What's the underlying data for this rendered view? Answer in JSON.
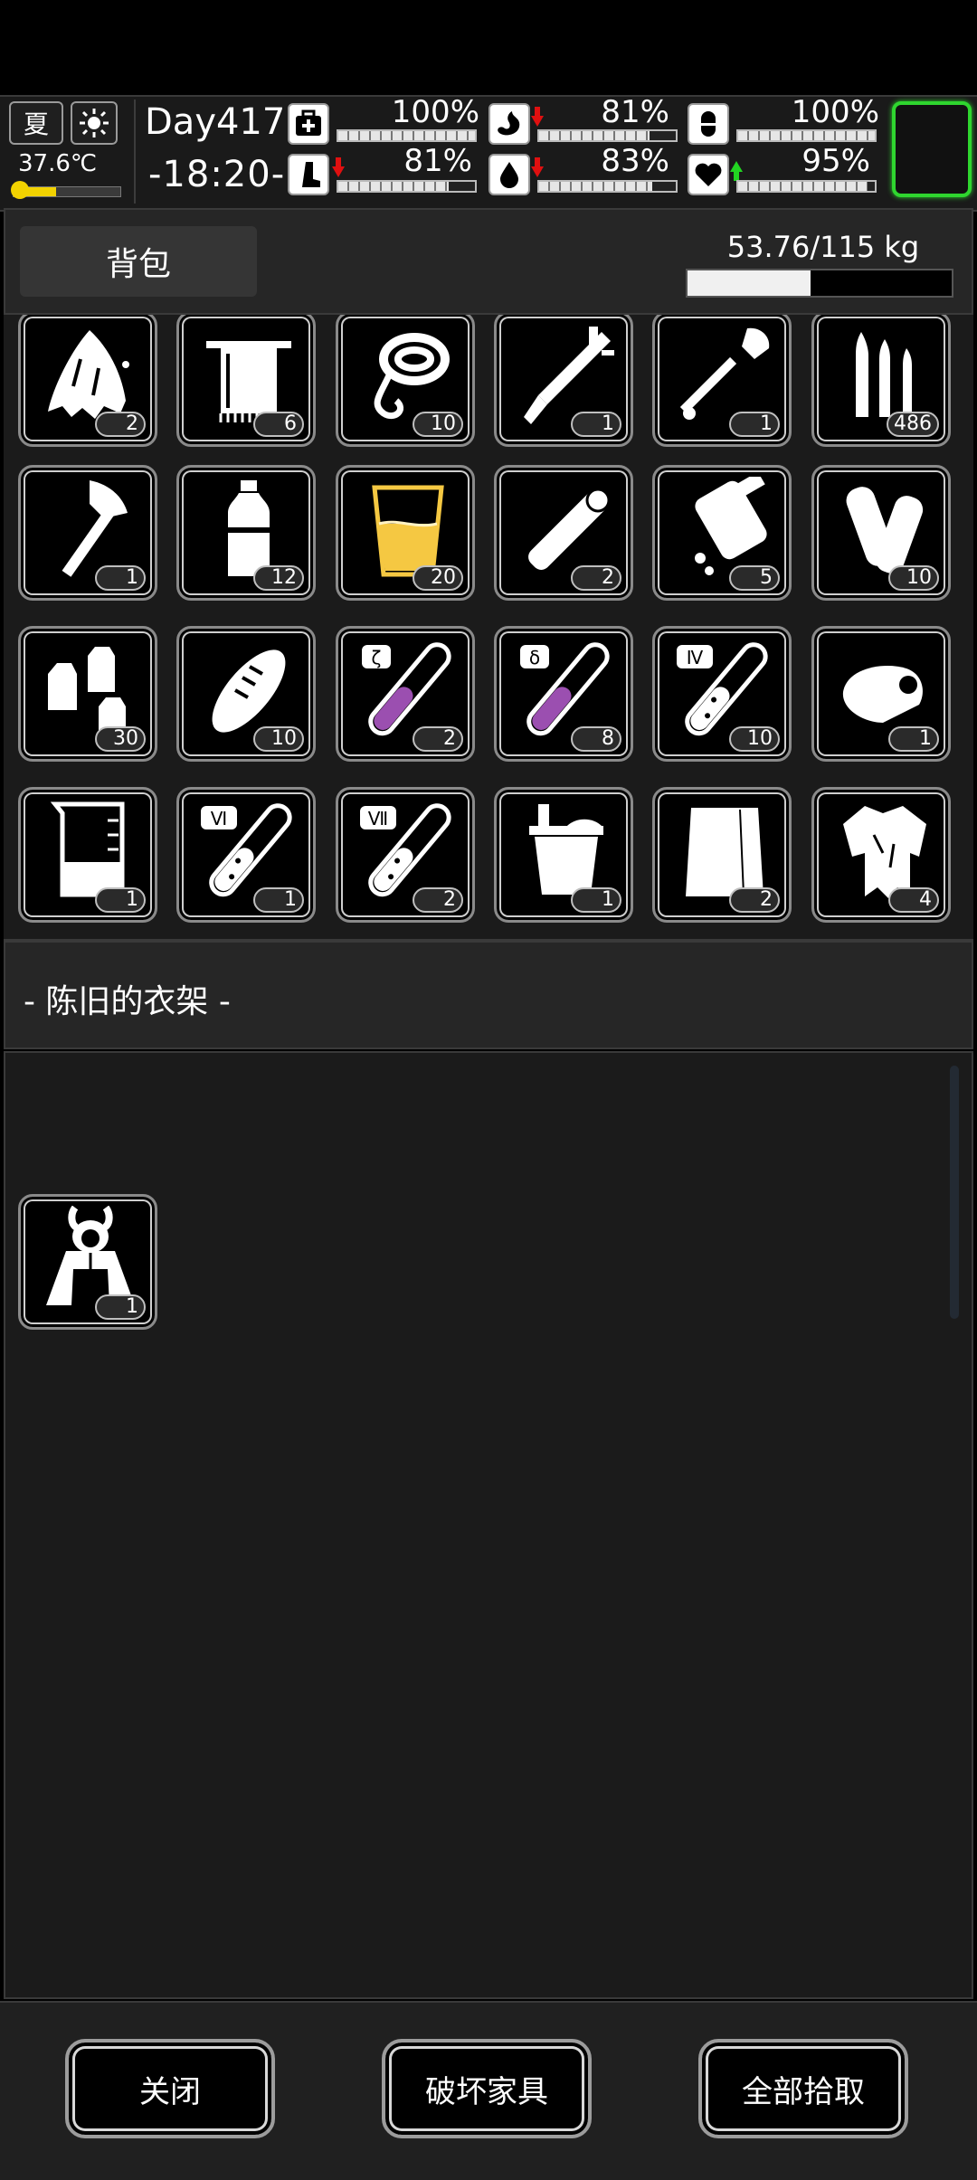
{
  "status": {
    "season": "夏",
    "weather_icon": "sun-icon",
    "temperature": "37.6℃",
    "day": "Day417",
    "time": "-18:20-",
    "stats": [
      {
        "name": "health",
        "icon": "first-aid-icon",
        "value": "100%",
        "level": 1.0,
        "trend": "none"
      },
      {
        "name": "hunger",
        "icon": "stomach-icon",
        "value": "81%",
        "level": 0.81,
        "trend": "down"
      },
      {
        "name": "sleep",
        "icon": "capsule-icon",
        "value": "100%",
        "level": 1.0,
        "trend": "none"
      },
      {
        "name": "stamina",
        "icon": "leg-icon",
        "value": "81%",
        "level": 0.81,
        "trend": "down"
      },
      {
        "name": "thirst",
        "icon": "water-drop-icon",
        "value": "83%",
        "level": 0.83,
        "trend": "down"
      },
      {
        "name": "mood",
        "icon": "heart-icon",
        "value": "95%",
        "level": 0.95,
        "trend": "up"
      }
    ],
    "equip_slot_color": "#2fd62f"
  },
  "bag": {
    "tab_label": "背包",
    "weight_text": "53.76/115 kg",
    "weight_level": 0.467
  },
  "inventory": [
    {
      "icon": "torn-cloth-icon",
      "count": "2"
    },
    {
      "icon": "towel-icon",
      "count": "6"
    },
    {
      "icon": "rope-icon",
      "count": "10"
    },
    {
      "icon": "caliper-knife-icon",
      "count": "1"
    },
    {
      "icon": "shovel-icon",
      "count": "1"
    },
    {
      "icon": "bullets-icon",
      "count": "486"
    },
    {
      "icon": "hatchet-icon",
      "count": "1"
    },
    {
      "icon": "water-bottle-icon",
      "count": "12"
    },
    {
      "icon": "glass-of-juice-icon",
      "count": "20"
    },
    {
      "icon": "bandage-roll-icon",
      "count": "2"
    },
    {
      "icon": "pill-bottle-icon",
      "count": "5"
    },
    {
      "icon": "paper-rolls-icon",
      "count": "10"
    },
    {
      "icon": "milk-bottles-icon",
      "count": "30"
    },
    {
      "icon": "bread-icon",
      "count": "10"
    },
    {
      "icon": "test-tube-zeta-icon",
      "count": "2",
      "label": "ζ"
    },
    {
      "icon": "test-tube-delta-icon",
      "count": "8",
      "label": "δ"
    },
    {
      "icon": "test-tube-iv-icon",
      "count": "10",
      "label": "Ⅳ"
    },
    {
      "icon": "cloth-bundle-icon",
      "count": "1"
    },
    {
      "icon": "beaker-icon",
      "count": "1"
    },
    {
      "icon": "test-tube-vi-icon",
      "count": "1",
      "label": "Ⅵ"
    },
    {
      "icon": "test-tube-vii-icon",
      "count": "2",
      "label": "Ⅶ"
    },
    {
      "icon": "bucket-icon",
      "count": "1"
    },
    {
      "icon": "cloth-sheet-icon",
      "count": "2"
    },
    {
      "icon": "ragged-shirt-icon",
      "count": "4"
    }
  ],
  "container": {
    "title": "- 陈旧的衣架 -",
    "items": [
      {
        "icon": "bunny-hoodie-icon",
        "count": "1"
      }
    ]
  },
  "footer": {
    "close_label": "关闭",
    "destroy_label": "破坏家具",
    "take_all_label": "全部拾取"
  },
  "colors": {
    "background": "#1b1b1b",
    "accent_green": "#2fd62f",
    "potion_purple": "#9b4fb0",
    "juice_yellow": "#f5c842",
    "trend_down": "#e01010",
    "trend_up": "#22d422"
  }
}
